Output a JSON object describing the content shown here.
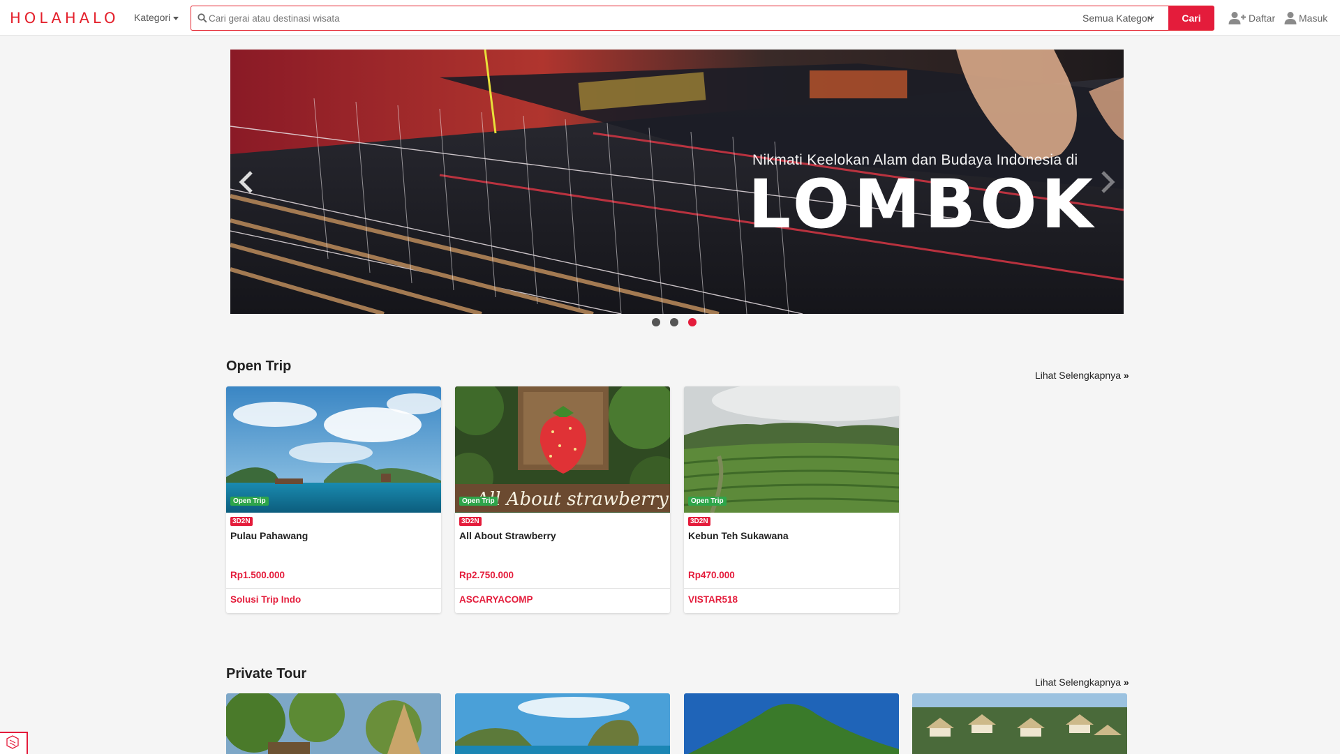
{
  "brand": {
    "logo": "HOLAHALO",
    "accent": "#e41c3b"
  },
  "nav": {
    "kategori": "Kategori",
    "search_placeholder": "Cari gerai atau destinasi wisata",
    "category_select": "Semua Kategori",
    "search_button": "Cari",
    "register": "Daftar",
    "login": "Masuk"
  },
  "carousel": {
    "subtitle": "Nikmati Keelokan Alam dan Budaya Indonesia di",
    "title": "LOMBOK",
    "slide_count": 3,
    "active_index": 3
  },
  "sections": [
    {
      "title": "Open Trip",
      "see_more": "Lihat Selengkapnya",
      "cards": [
        {
          "badge": "Open Trip",
          "duration": "3D2N",
          "name": "Pulau Pahawang",
          "price": "Rp1.500.000",
          "vendor": "Solusi Trip Indo"
        },
        {
          "badge": "Open Trip",
          "duration": "3D2N",
          "name": "All About Strawberry",
          "price": "Rp2.750.000",
          "vendor": "ASCARYACOMP"
        },
        {
          "badge": "Open Trip",
          "duration": "3D2N",
          "name": "Kebun Teh Sukawana",
          "price": "Rp470.000",
          "vendor": "VISTAR518"
        }
      ]
    },
    {
      "title": "Private Tour",
      "see_more": "Lihat Selengkapnya"
    }
  ]
}
